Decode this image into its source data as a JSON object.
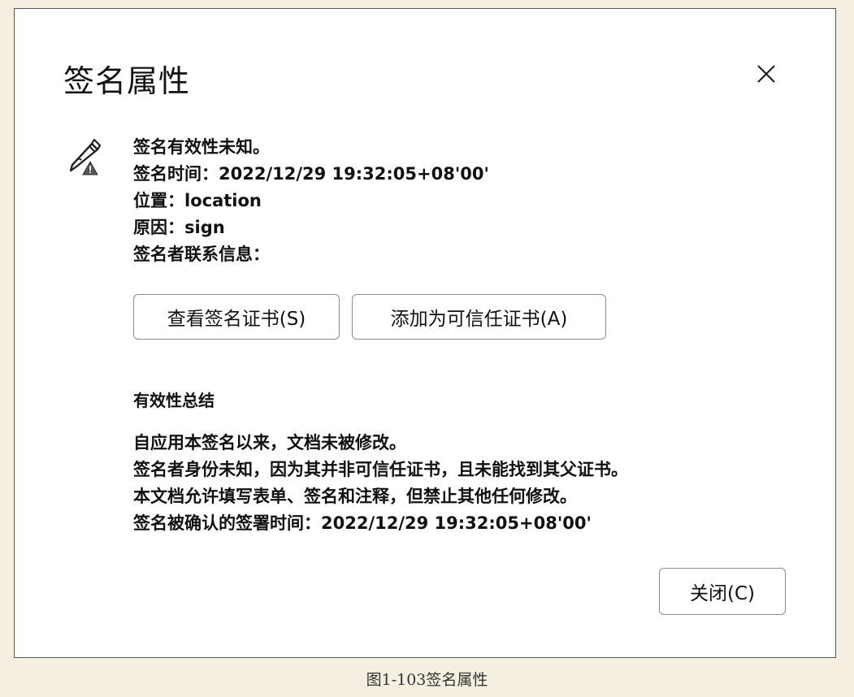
{
  "dialog": {
    "title": "签名属性",
    "close_icon": "close-icon",
    "status_icon": "signature-pen-warning-icon",
    "info_lines": [
      "签名有效性未知。",
      "签名时间：2022/12/29 19:32:05+08'00'",
      "位置：location",
      "原因：sign",
      "签名者联系信息："
    ],
    "buttons": {
      "view_certificate": "查看签名证书(S)",
      "add_trusted": "添加为可信任证书(A)",
      "close": "关闭(C)"
    },
    "summary_heading": "有效性总结",
    "summary_lines": [
      "自应用本签名以来，文档未被修改。",
      "签名者身份未知，因为其并非可信任证书，且未能找到其父证书。",
      "本文档允许填写表单、签名和注释，但禁止其他任何修改。",
      "签名被确认的签署时间：2022/12/29 19:32:05+08'00'"
    ]
  },
  "caption": "图1-103签名属性"
}
